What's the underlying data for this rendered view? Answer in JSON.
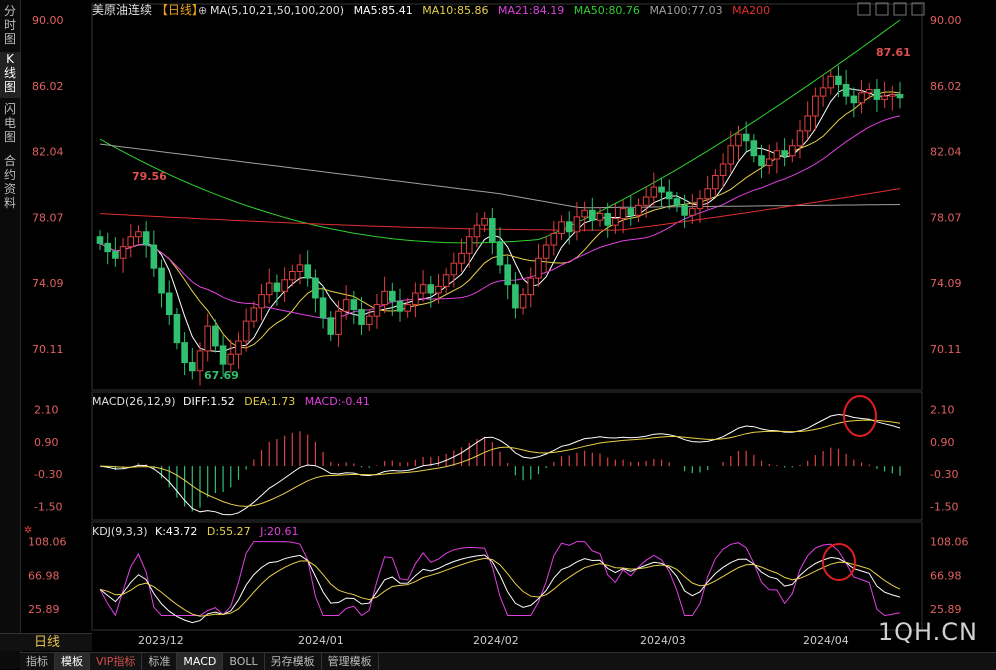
{
  "side_tabs": [
    "分\n时\n图",
    "K\n线\n图",
    "闪\n电\n图",
    "合\n约\n资\n料"
  ],
  "header": {
    "title": "美原油连续",
    "period": "【日线】",
    "ma_params": "MA(5,10,21,50,100,200)",
    "ma5": "MA5:85.41",
    "ma10": "MA10:85.86",
    "ma21": "MA21:84.19",
    "ma50": "MA50:80.76",
    "ma100": "MA100:77.03",
    "ma200": "MA200"
  },
  "price_axis": [
    "90.00",
    "86.02",
    "82.04",
    "78.07",
    "74.09",
    "70.11"
  ],
  "annotations": {
    "high1": "79.56",
    "low1": "67.69",
    "high2": "87.61"
  },
  "macd": {
    "label": "MACD(26,12,9)",
    "diff": "DIFF:1.52",
    "dea": "DEA:1.73",
    "macd": "MACD:-0.41",
    "axis": [
      "2.10",
      "0.90",
      "-0.30",
      "-1.50"
    ]
  },
  "kdj": {
    "label": "KDJ(9,3,3)",
    "k": "K:43.72",
    "d": "D:55.27",
    "j": "J:20.61",
    "axis": [
      "108.06",
      "66.98",
      "25.89"
    ]
  },
  "dates": [
    "2023/12",
    "2024/01",
    "2024/02",
    "2024/03",
    "2024/04"
  ],
  "day_button": "日线",
  "bottom_tabs": [
    "指标",
    "模板",
    "VIP指标",
    "标准",
    "MACD",
    "BOLL",
    "另存模板",
    "管理模板"
  ],
  "watermark": "1QH.CN",
  "colors": {
    "up": "#e04040",
    "down": "#30c070",
    "ma5": "#ffffff",
    "ma10": "#e8d048",
    "ma21": "#e040e0",
    "ma50": "#30d030",
    "ma100": "#a0a0a0",
    "ma200": "#e03030"
  },
  "chart_data": {
    "type": "candlestick",
    "ylim": [
      68.0,
      90.0
    ],
    "closes": [
      76.5,
      76.0,
      75.6,
      76.3,
      76.9,
      77.2,
      76.4,
      75.0,
      73.5,
      72.2,
      70.5,
      69.3,
      68.8,
      70.0,
      71.5,
      70.3,
      69.2,
      69.8,
      70.6,
      71.8,
      72.6,
      73.4,
      74.1,
      73.6,
      74.3,
      74.8,
      75.2,
      74.4,
      73.2,
      72.0,
      71.0,
      72.4,
      73.1,
      72.5,
      71.6,
      72.1,
      72.8,
      73.6,
      73.0,
      72.4,
      72.8,
      73.5,
      74.0,
      73.5,
      73.9,
      74.6,
      75.3,
      75.9,
      76.9,
      77.6,
      78.0,
      76.6,
      75.2,
      74.0,
      72.6,
      73.4,
      74.4,
      75.6,
      76.4,
      77.1,
      77.8,
      77.2,
      78.1,
      78.5,
      77.9,
      78.3,
      77.6,
      78.0,
      78.6,
      78.2,
      78.8,
      79.3,
      79.9,
      79.6,
      79.2,
      78.8,
      78.2,
      78.6,
      79.2,
      79.8,
      80.6,
      81.3,
      82.4,
      83.1,
      82.7,
      81.8,
      81.2,
      81.6,
      82.1,
      81.8,
      82.4,
      83.3,
      84.2,
      85.4,
      85.9,
      86.6,
      86.1,
      85.4,
      85.0,
      85.6,
      85.8,
      85.2,
      85.4,
      85.5,
      85.3
    ],
    "macd_diff_range": [
      -1.7,
      2.3
    ],
    "kdj_range": [
      15,
      110
    ]
  }
}
